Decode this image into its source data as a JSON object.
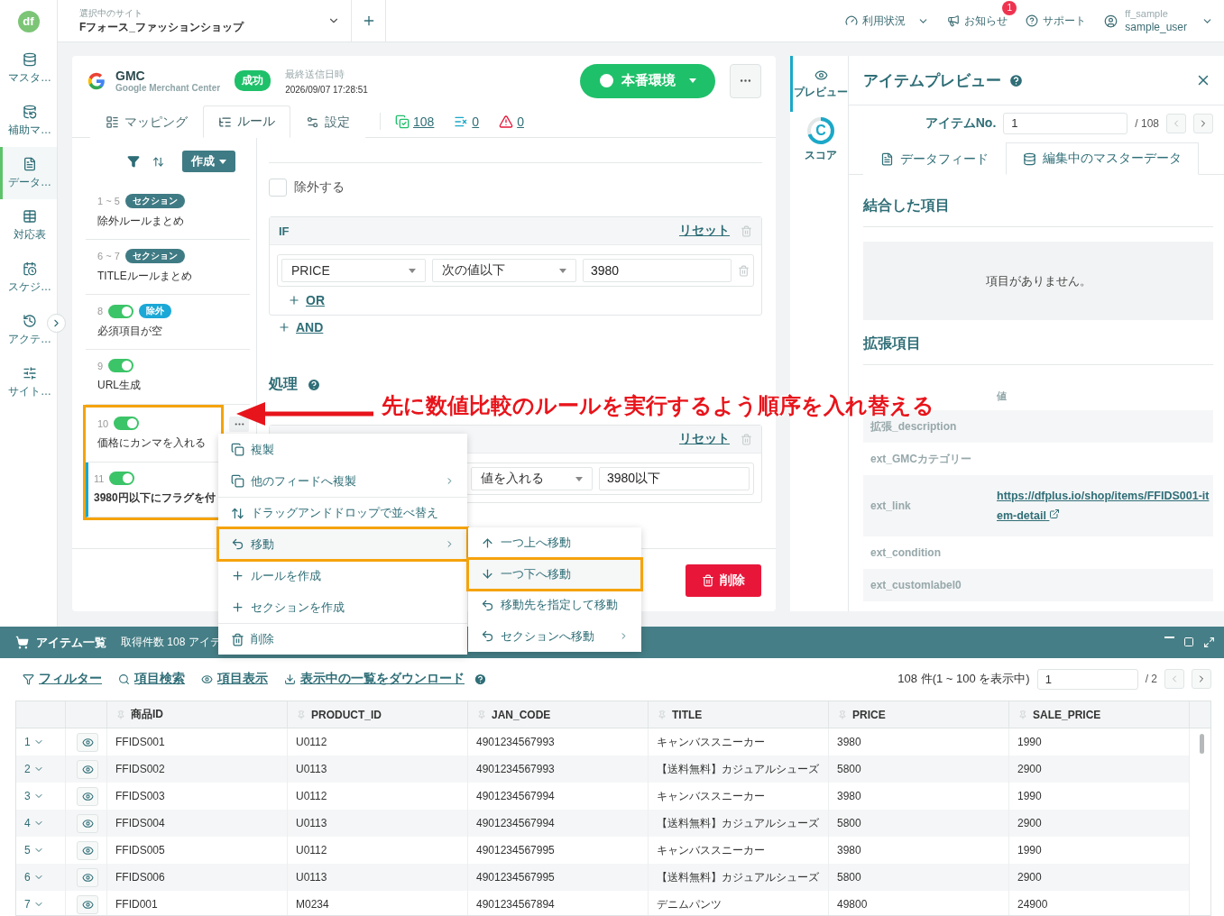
{
  "header": {
    "logo": "df",
    "site_label": "選択中のサイト",
    "site_name": "Fフォース_ファッションショップ",
    "nav": [
      {
        "label": "利用状況",
        "kind": "dropdown"
      },
      {
        "label": "お知らせ",
        "kind": "notice",
        "badge": "1"
      },
      {
        "label": "サポート",
        "kind": "help"
      }
    ],
    "user": {
      "org": "ff_sample",
      "name": "sample_user"
    }
  },
  "sidebar": {
    "items": [
      {
        "label": "マスタ…",
        "selected": false
      },
      {
        "label": "補助マ…",
        "selected": false
      },
      {
        "label": "データ…",
        "selected": true
      },
      {
        "label": "対応表",
        "selected": false
      },
      {
        "label": "スケジ…",
        "selected": false
      },
      {
        "label": "アクテ…",
        "selected": false
      },
      {
        "label": "サイト…",
        "selected": false
      }
    ]
  },
  "feed": {
    "name": "GMC",
    "subtitle": "Google Merchant Center",
    "status": "成功",
    "last_sent_label": "最終送信日時",
    "last_sent": "2026/09/07 17:28:51",
    "environment": "本番環境"
  },
  "tabs": [
    {
      "label": "マッピング",
      "selected": false
    },
    {
      "label": "ルール",
      "selected": true
    },
    {
      "label": "設定",
      "selected": false
    }
  ],
  "stats": [
    {
      "kind": "ok",
      "value": "108"
    },
    {
      "kind": "excluded",
      "value": "0"
    },
    {
      "kind": "error",
      "value": "0"
    }
  ],
  "rules": {
    "create_button": "作成",
    "items": [
      {
        "kind": "section",
        "number": "1 ~ 5",
        "tag": "セクション",
        "name": "除外ルールまとめ",
        "selected": false,
        "highlighted": false
      },
      {
        "kind": "section",
        "number": "6 ~ 7",
        "tag": "セクション",
        "name": "TITLEルールまとめ",
        "selected": false,
        "highlighted": false
      },
      {
        "kind": "rule",
        "number": "8",
        "on": true,
        "tag": "除外",
        "name": "必須項目が空",
        "selected": false,
        "highlighted": false
      },
      {
        "kind": "rule",
        "number": "9",
        "on": true,
        "name": "URL生成",
        "selected": false,
        "highlighted": false
      },
      {
        "kind": "rule",
        "number": "10",
        "on": true,
        "name": "価格にカンマを入れる",
        "selected": false,
        "highlighted": true
      },
      {
        "kind": "rule",
        "number": "11",
        "on": true,
        "name": "3980円以下にフラグを付",
        "selected": true,
        "highlighted": true
      }
    ]
  },
  "editor": {
    "exclude": {
      "label": "除外する",
      "checked": false
    },
    "condition": {
      "title": "IF",
      "reset": "リセット",
      "rows": [
        {
          "field": "PRICE",
          "operator": "次の値以下",
          "value": "3980"
        }
      ],
      "or": "OR",
      "and": "AND"
    },
    "process": {
      "title": "処理",
      "reset": "リセット",
      "action": "値を入れる",
      "value": "3980以下"
    },
    "delete": "削除"
  },
  "context_menu": {
    "items": [
      {
        "label": "複製",
        "submenu": false,
        "highlighted": false
      },
      {
        "label": "他のフィードへ複製",
        "submenu": true,
        "highlighted": false
      },
      {
        "label": "ドラッグアンドドロップで並べ替え",
        "submenu": false,
        "highlighted": false
      },
      {
        "label": "移動",
        "submenu": true,
        "highlighted": true
      },
      {
        "label": "ルールを作成",
        "submenu": false,
        "highlighted": false
      },
      {
        "label": "セクションを作成",
        "submenu": false,
        "highlighted": false
      },
      {
        "label": "削除",
        "submenu": false,
        "highlighted": false
      }
    ]
  },
  "move_menu": {
    "items": [
      {
        "label": "一つ上へ移動",
        "submenu": false,
        "highlighted": false
      },
      {
        "label": "一つ下へ移動",
        "submenu": false,
        "highlighted": true
      },
      {
        "label": "移動先を指定して移動",
        "submenu": false,
        "highlighted": false
      },
      {
        "label": "セクションへ移動",
        "submenu": true,
        "highlighted": false
      }
    ]
  },
  "annotation": {
    "text": "先に数値比較のルールを実行するよう順序を入れ替える"
  },
  "preview": {
    "vtabs": [
      {
        "label": "プレビュー",
        "selected": true
      },
      {
        "label": "スコア",
        "selected": false
      }
    ],
    "score_grade": "C",
    "title": "アイテムプレビュー",
    "item_no_label": "アイテムNo.",
    "item_no": "1",
    "item_total": "/ 108",
    "tabs": [
      {
        "label": "データフィード",
        "selected": false
      },
      {
        "label": "編集中のマスターデータ",
        "selected": true
      }
    ],
    "combined_title": "結合した項目",
    "empty": "項目がありません。",
    "extended_title": "拡張項目",
    "value_header": "値",
    "rows": [
      {
        "kind": "text",
        "name": "拡張_description"
      },
      {
        "kind": "text",
        "name": "ext_GMCカテゴリー"
      },
      {
        "kind": "link",
        "name": "ext_link",
        "value": "https://dfplus.io/shop/items/FFIDS001-item-detail"
      },
      {
        "kind": "text",
        "name": "ext_condition"
      },
      {
        "kind": "text",
        "name": "ext_customlabel0"
      }
    ]
  },
  "items_panel": {
    "title": "アイテム一覧",
    "count": "取得件数 108 アイテ",
    "tools": [
      "フィルター",
      "項目検索",
      "項目表示",
      "表示中の一覧をダウンロード"
    ],
    "range": "108 件(1 ~ 100 を表示中)",
    "page": "1",
    "pages": "/ 2",
    "columns": [
      "商品ID",
      "PRODUCT_ID",
      "JAN_CODE",
      "TITLE",
      "PRICE",
      "SALE_PRICE"
    ],
    "rows": [
      {
        "index": "1",
        "cells": [
          "FFIDS001",
          "U0112",
          "4901234567993",
          "キャンバススニーカー",
          "3980",
          "1990"
        ]
      },
      {
        "index": "2",
        "cells": [
          "FFIDS002",
          "U0113",
          "4901234567993",
          "【送料無料】カジュアルシューズ",
          "5800",
          "2900"
        ]
      },
      {
        "index": "3",
        "cells": [
          "FFIDS003",
          "U0112",
          "4901234567994",
          "キャンバススニーカー",
          "3980",
          "1990"
        ]
      },
      {
        "index": "4",
        "cells": [
          "FFIDS004",
          "U0113",
          "4901234567994",
          "【送料無料】カジュアルシューズ",
          "5800",
          "2900"
        ]
      },
      {
        "index": "5",
        "cells": [
          "FFIDS005",
          "U0112",
          "4901234567995",
          "キャンバススニーカー",
          "3980",
          "1990"
        ]
      },
      {
        "index": "6",
        "cells": [
          "FFIDS006",
          "U0113",
          "4901234567995",
          "【送料無料】カジュアルシューズ",
          "5800",
          "2900"
        ]
      },
      {
        "index": "7",
        "cells": [
          "FFID001",
          "M0234",
          "4901234567894",
          "デニムパンツ",
          "49800",
          "24900"
        ]
      }
    ]
  }
}
